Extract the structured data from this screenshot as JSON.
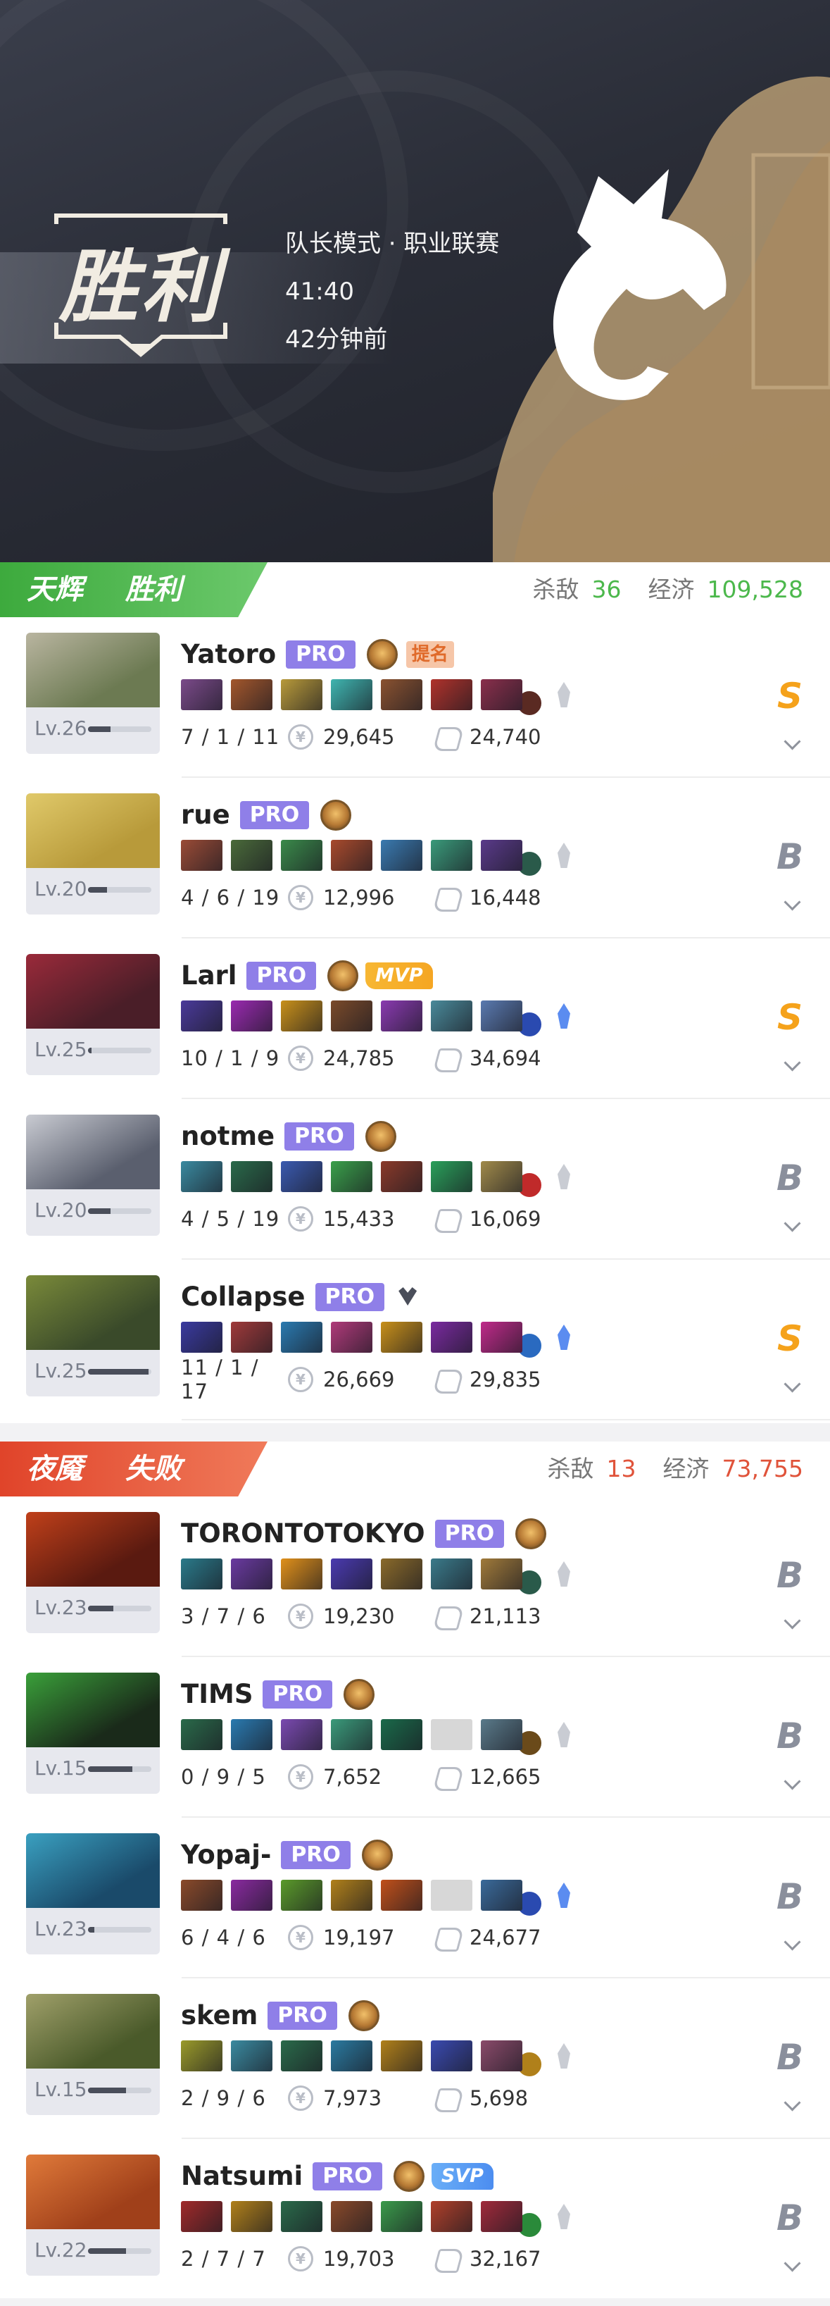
{
  "header": {
    "result": "胜利",
    "mode": "队长模式 · 职业联赛",
    "duration": "41:40",
    "time_ago": "42分钟前"
  },
  "radiant": {
    "side": "天辉",
    "result": "胜利",
    "kills_label": "杀敌",
    "kills": "36",
    "net_label": "经济",
    "net": "109,528",
    "color": "#4cb84c",
    "players": [
      {
        "name": "Yatoro",
        "pro": "PRO",
        "level": "Lv.26",
        "xp": 0.35,
        "kda": "7 / 1 / 11",
        "gold": "29,645",
        "damage": "24,740",
        "rank": "S",
        "tag": "提名",
        "hero_colors": [
          "#6c7a52",
          "#b9b5a0"
        ],
        "items": [
          "#7b4a8a",
          "#a3572c",
          "#b89a3a",
          "#3fb5b0",
          "#8a5230",
          "#b0322b",
          "#8a2f4c"
        ],
        "neutral": "#5a2a22",
        "shard": false
      },
      {
        "name": "rue",
        "pro": "PRO",
        "level": "Lv.20",
        "xp": 0.3,
        "kda": "4 / 6 / 19",
        "gold": "12,996",
        "damage": "16,448",
        "rank": "B",
        "hero_colors": [
          "#b89a3a",
          "#e0c96a"
        ],
        "items": [
          "#9a4b36",
          "#4a6a3a",
          "#3a8a4a",
          "#a84a2c",
          "#3a7ab0",
          "#3a9a7a",
          "#5a3a8a"
        ],
        "neutral": "#2a5a4a",
        "shard": false
      },
      {
        "name": "Larl",
        "pro": "PRO",
        "level": "Lv.25",
        "xp": 0.05,
        "kda": "10 / 1 / 9",
        "gold": "24,785",
        "damage": "34,694",
        "rank": "S",
        "tag": "MVP",
        "hero_colors": [
          "#4a1e28",
          "#9a2a3a"
        ],
        "items": [
          "#4a3a9a",
          "#9a2ab0",
          "#c8901a",
          "#7a4a2a",
          "#8a3ab0",
          "#4a8a9a",
          "#5a7ab0"
        ],
        "neutral": "#2a4ab0",
        "shard": true
      },
      {
        "name": "notme",
        "pro": "PRO",
        "level": "Lv.20",
        "xp": 0.35,
        "kda": "4 / 5 / 19",
        "gold": "15,433",
        "damage": "16,069",
        "rank": "B",
        "hero_colors": [
          "#5a5f6e",
          "#c9cbd2"
        ],
        "items": [
          "#3a8aa0",
          "#2a6a4a",
          "#3a5ab0",
          "#3aa04a",
          "#8a3a2a",
          "#2aa05a",
          "#a08a4a"
        ],
        "neutral": "#c02a2a",
        "shard": false
      },
      {
        "name": "Collapse",
        "pro": "PRO",
        "level": "Lv.25",
        "xp": 0.95,
        "kda": "11 / 1 / 17",
        "gold": "26,669",
        "damage": "29,835",
        "rank": "S",
        "tag": "immortal",
        "hero_colors": [
          "#3a4a2a",
          "#7a8a3a"
        ],
        "items": [
          "#3a3aa0",
          "#a03a3a",
          "#2a7ab0",
          "#b03a7a",
          "#c8901a",
          "#7a2aa0",
          "#c02a8a"
        ],
        "neutral": "#2a6ac0",
        "shard": true
      }
    ]
  },
  "dire": {
    "side": "夜魇",
    "result": "失败",
    "kills_label": "杀敌",
    "kills": "13",
    "net_label": "经济",
    "net": "73,755",
    "color": "#e0533a",
    "players": [
      {
        "name": "TORONTOTOKYO",
        "pro": "PRO",
        "level": "Lv.23",
        "xp": 0.4,
        "kda": "3 / 7 / 6",
        "gold": "19,230",
        "damage": "21,113",
        "rank": "B",
        "hero_colors": [
          "#5a1a10",
          "#c0401a"
        ],
        "items": [
          "#2a7a8a",
          "#6a3aa0",
          "#e0901a",
          "#4a3ab0",
          "#8a6a2a",
          "#3a7a8a",
          "#a07a3a"
        ],
        "neutral": "#2a5a4a",
        "shard": false
      },
      {
        "name": "TIMS",
        "pro": "PRO",
        "level": "Lv.15",
        "xp": 0.7,
        "kda": "0 / 9 / 5",
        "gold": "7,652",
        "damage": "12,665",
        "rank": "B",
        "hero_colors": [
          "#1a2a1a",
          "#3aa03a"
        ],
        "items": [
          "#2a6a4a",
          "#2a7ab0",
          "#7a4ab0",
          "#3a9a7a",
          "#1a6a4a",
          null,
          "#5a7a8a"
        ],
        "neutral": "#6a4a1a",
        "shard": false
      },
      {
        "name": "Yopaj-",
        "pro": "PRO",
        "level": "Lv.23",
        "xp": 0.1,
        "kda": "6 / 4 / 6",
        "gold": "19,197",
        "damage": "24,677",
        "rank": "B",
        "hero_colors": [
          "#1a4a6a",
          "#3aa0c0"
        ],
        "items": [
          "#8a4a2a",
          "#8a2aa0",
          "#5a9a2a",
          "#b0801a",
          "#c0501a",
          null,
          "#3a6a9a"
        ],
        "neutral": "#2a4ab0",
        "shard": true
      },
      {
        "name": "skem",
        "pro": "PRO",
        "level": "Lv.15",
        "xp": 0.6,
        "kda": "2 / 9 / 6",
        "gold": "7,973",
        "damage": "5,698",
        "rank": "B",
        "hero_colors": [
          "#4a5a2a",
          "#a0a06a"
        ],
        "items": [
          "#9a9a2a",
          "#3a8aa0",
          "#2a6a4a",
          "#2a7aa0",
          "#b0801a",
          "#3a4ab0",
          "#8a4a6a"
        ],
        "neutral": "#b0801a",
        "shard": false
      },
      {
        "name": "Natsumi",
        "pro": "PRO",
        "level": "Lv.22",
        "xp": 0.6,
        "kda": "2 / 7 / 7",
        "gold": "19,703",
        "damage": "32,167",
        "rank": "B",
        "tag": "SVP",
        "hero_colors": [
          "#a0401a",
          "#e07a3a"
        ],
        "items": [
          "#a02a2a",
          "#b0801a",
          "#2a6a4a",
          "#8a4a2a",
          "#3a9a4a",
          "#b0402a",
          "#a02a3a"
        ],
        "neutral": "#2a8a3a",
        "shard": false
      }
    ]
  }
}
